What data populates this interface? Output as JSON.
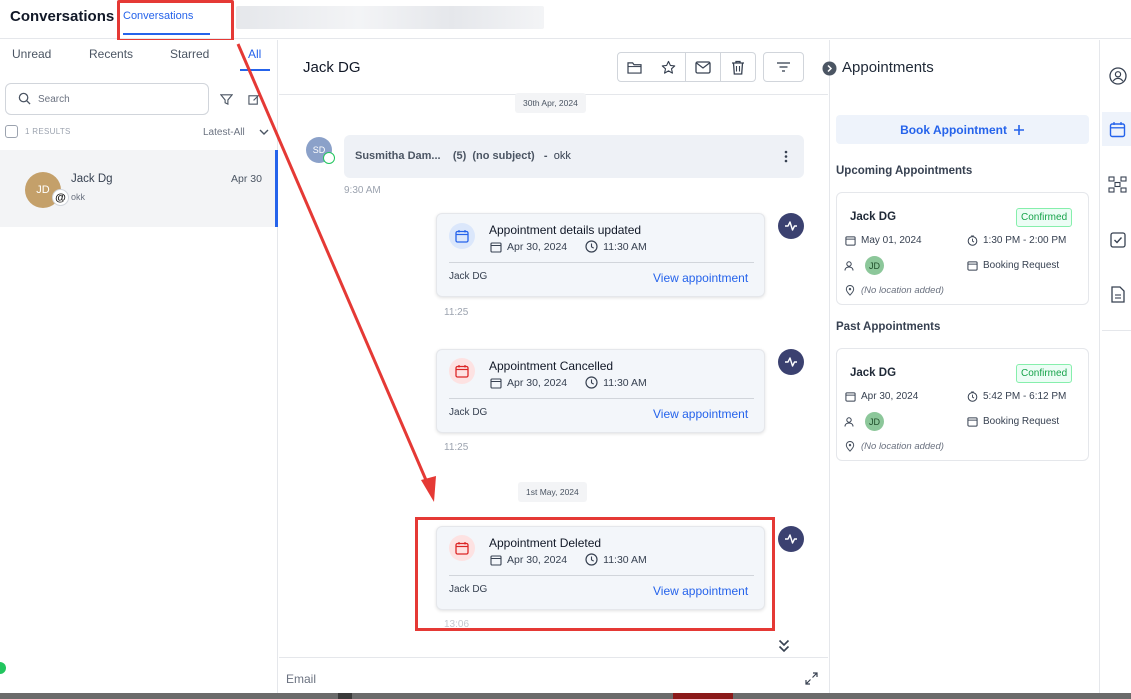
{
  "app": {
    "title": "Conversations",
    "tab": "Conversations"
  },
  "sidebar": {
    "tabs": [
      "Unread",
      "Recents",
      "Starred",
      "All"
    ],
    "search_placeholder": "Search",
    "results": "1 RESULTS",
    "sort": "Latest-All",
    "conversation": {
      "initials": "JD",
      "name": "Jack Dg",
      "snippet": "okk",
      "date": "Apr 30"
    }
  },
  "thread": {
    "contact": "Jack DG",
    "date1": "30th Apr, 2024",
    "date2": "1st May, 2024",
    "email": {
      "initials": "SD",
      "sender": "Susmitha Dam...",
      "count": "(5)",
      "subject": "(no subject)",
      "dash": "-",
      "body": "okk",
      "time": "9:30 AM"
    },
    "cards": [
      {
        "title": "Appointment details updated",
        "date": "Apr 30, 2024",
        "time": "11:30 AM",
        "contact": "Jack DG",
        "link": "View appointment",
        "stamp": "11:25"
      },
      {
        "title": "Appointment Cancelled",
        "date": "Apr 30, 2024",
        "time": "11:30 AM",
        "contact": "Jack DG",
        "link": "View appointment",
        "stamp": "11:25"
      },
      {
        "title": "Appointment Deleted",
        "date": "Apr 30, 2024",
        "time": "11:30 AM",
        "contact": "Jack DG",
        "link": "View appointment",
        "stamp": "13:06"
      }
    ],
    "composer_label": "Email"
  },
  "appointments": {
    "title": "Appointments",
    "book_label": "Book Appointment",
    "upcoming_title": "Upcoming Appointments",
    "past_title": "Past Appointments",
    "upcoming": {
      "name": "Jack DG",
      "status": "Confirmed",
      "date": "May 01, 2024",
      "time": "1:30 PM - 2:00 PM",
      "initials": "JD",
      "type": "Booking Request",
      "location": "(No location added)"
    },
    "past": {
      "name": "Jack DG",
      "status": "Confirmed",
      "date": "Apr 30, 2024",
      "time": "5:42 PM - 6:12 PM",
      "initials": "JD",
      "type": "Booking Request",
      "location": "(No location added)"
    }
  },
  "colors": {
    "accent": "#2563eb",
    "highlight": "#e53935",
    "confirmed": "#16a34a",
    "activity": "#3b4170"
  }
}
